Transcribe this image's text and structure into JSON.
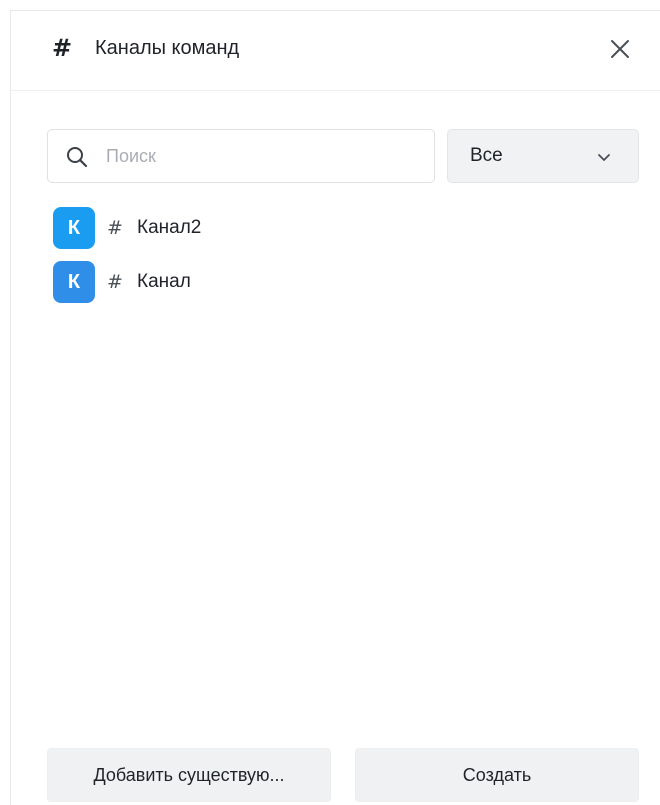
{
  "header": {
    "icon": "hash-icon",
    "title": "Каналы команд",
    "close_icon": "close-icon"
  },
  "search": {
    "placeholder": "Поиск",
    "value": "",
    "icon": "search-icon"
  },
  "filter": {
    "selected": "Все",
    "icon": "chevron-down-icon"
  },
  "channels": [
    {
      "avatar_letter": "К",
      "avatar_color": "#1a9cf0",
      "hash": "#",
      "name": "Канал2"
    },
    {
      "avatar_letter": "К",
      "avatar_color": "#2f8fe8",
      "hash": "#",
      "name": "Канал"
    }
  ],
  "footer": {
    "add_existing_label": "Добавить существую...",
    "create_label": "Создать"
  }
}
